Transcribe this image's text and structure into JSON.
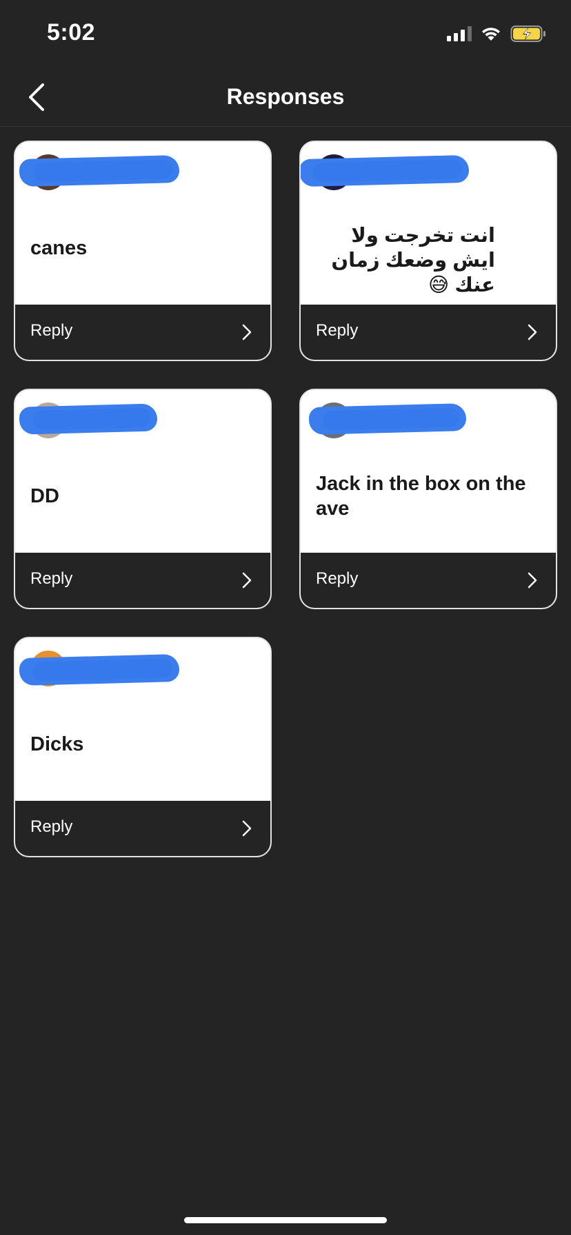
{
  "status_bar": {
    "time": "5:02",
    "icons": [
      "cellular-signal-icon",
      "wifi-icon",
      "battery-charging-icon"
    ],
    "battery_color": "#f5d547"
  },
  "nav": {
    "title": "Responses",
    "back_icon": "chevron-left-icon"
  },
  "responses": [
    {
      "message": "canes",
      "reply_label": "Reply",
      "avatar_color": "#5a3a2a",
      "direction": "ltr"
    },
    {
      "message": "انت تخرجت ولا ايش وضعك زمان عنك 😅",
      "reply_label": "Reply",
      "avatar_color": "#1e1b45",
      "direction": "rtl"
    },
    {
      "message": "DD",
      "reply_label": "Reply",
      "avatar_color": "#b9a99b",
      "direction": "ltr"
    },
    {
      "message": "Jack in the box on the ave",
      "reply_label": "Reply",
      "avatar_color": "#6b6f7a",
      "direction": "ltr"
    },
    {
      "message": "Dicks",
      "reply_label": "Reply",
      "avatar_color": "#e8902e",
      "direction": "ltr"
    }
  ],
  "colors": {
    "background": "#242424",
    "card": "#ffffff",
    "card_border": "#e3e3e3",
    "redaction": "#3b7ded"
  }
}
